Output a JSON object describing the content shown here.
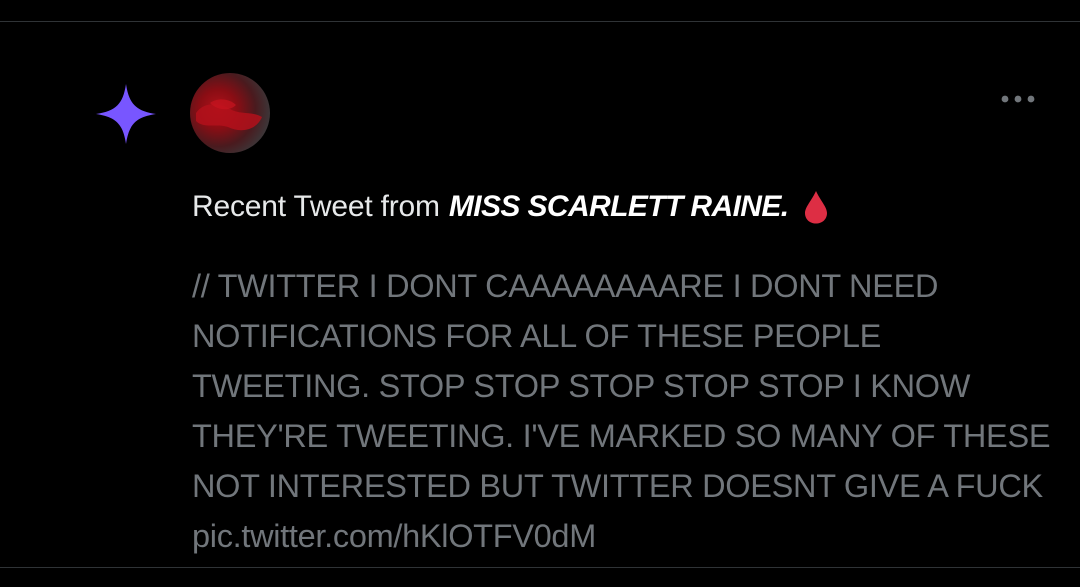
{
  "notification": {
    "icon": "sparkle-icon",
    "icon_color": "#7856ff",
    "avatar": "user-avatar",
    "more_icon": "more-options-icon",
    "headline_prefix": "Recent Tweet from",
    "user_name": "MISS SCARLETT RAINE.",
    "emoji": "drop-of-blood-icon",
    "emoji_color": "#dd2e44",
    "tweet_text": "// TWITTER I DONT CAAAAAAAARE I DONT NEED NOTIFICATIONS FOR ALL OF THESE PEOPLE TWEETING. STOP STOP STOP STOP STOP I KNOW THEY'RE TWEETING. I'VE MARKED SO MANY OF THESE NOT INTERESTED BUT TWITTER DOESNT GIVE A FUCK",
    "pic_link": "pic.twitter.com/hKlOTFV0dM"
  },
  "colors": {
    "background": "#000000",
    "divider": "#2f3336",
    "primary_text": "#e7e9ea",
    "secondary_text": "#71767b"
  }
}
